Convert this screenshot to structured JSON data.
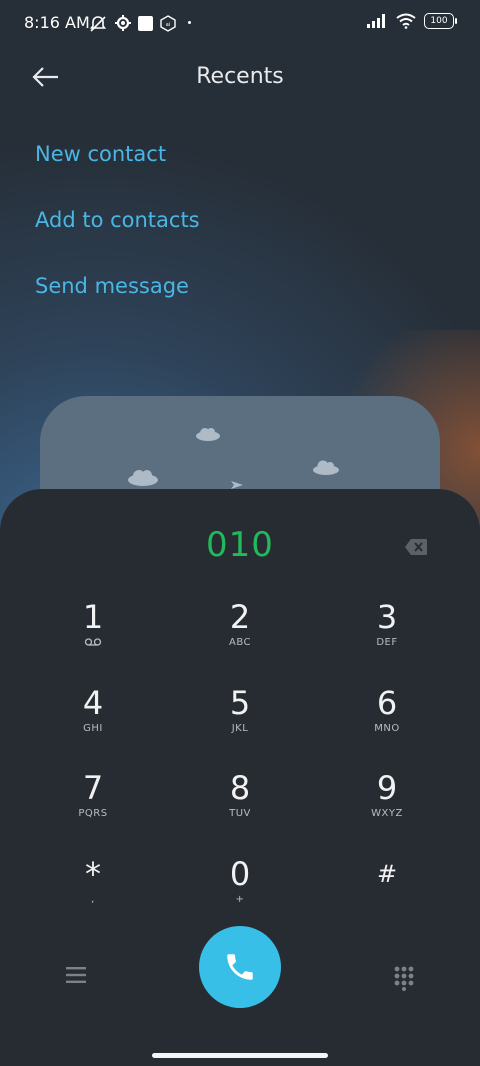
{
  "status_bar": {
    "time": "8:16 AM",
    "battery": "100",
    "icons": [
      "mute-icon",
      "gear-icon",
      "square-icon",
      "hex-icon",
      "dot-icon",
      "signal-icon",
      "wifi-icon",
      "battery-icon"
    ]
  },
  "header": {
    "title": "Recents",
    "back_icon": "back-arrow-icon"
  },
  "actions": [
    {
      "label": "New contact"
    },
    {
      "label": "Add to contacts"
    },
    {
      "label": "Send message"
    }
  ],
  "dialer": {
    "number": "010",
    "number_color": "#22b85c",
    "keys": [
      {
        "digit": "1",
        "letters": ""
      },
      {
        "digit": "2",
        "letters": "ABC"
      },
      {
        "digit": "3",
        "letters": "DEF"
      },
      {
        "digit": "4",
        "letters": "GHI"
      },
      {
        "digit": "5",
        "letters": "JKL"
      },
      {
        "digit": "6",
        "letters": "MNO"
      },
      {
        "digit": "7",
        "letters": "PQRS"
      },
      {
        "digit": "8",
        "letters": "TUV"
      },
      {
        "digit": "9",
        "letters": "WXYZ"
      },
      {
        "digit": "*",
        "letters": ","
      },
      {
        "digit": "0",
        "letters": "+"
      },
      {
        "digit": "#",
        "letters": ""
      }
    ],
    "call_color": "#38bfe7",
    "accent": "#4ab6e3"
  }
}
